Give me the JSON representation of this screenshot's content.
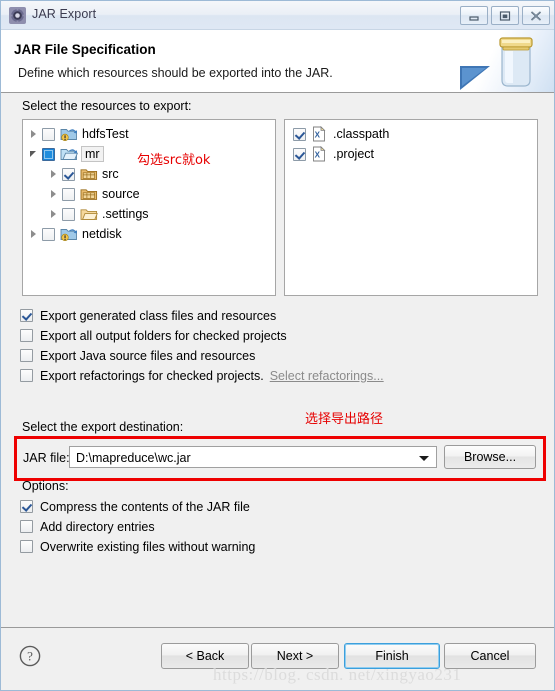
{
  "window": {
    "title": "JAR Export",
    "title_icon": "jar-export-icon",
    "controls": {
      "minimize": "minimize-icon",
      "maximize": "maximize-icon",
      "close": "close-icon"
    }
  },
  "header": {
    "title": "JAR File Specification",
    "subtitle": "Define which resources should be exported into the JAR.",
    "art_icon": "jar-jar-illustration"
  },
  "resources": {
    "label": "Select the resources to export:",
    "tree": [
      {
        "label": "hdfsTest",
        "icon": "java-project-icon",
        "checked": "none",
        "expandable": true,
        "expanded": false,
        "indent": 0,
        "selected": false
      },
      {
        "label": "mr",
        "icon": "project-open-icon",
        "checked": "partial",
        "expandable": true,
        "expanded": true,
        "indent": 0,
        "selected": true
      },
      {
        "label": "src",
        "icon": "package-folder-icon",
        "checked": "checked",
        "expandable": true,
        "expanded": false,
        "indent": 1,
        "selected": false
      },
      {
        "label": "source",
        "icon": "package-folder-icon",
        "checked": "none",
        "expandable": true,
        "expanded": false,
        "indent": 1,
        "selected": false
      },
      {
        "label": ".settings",
        "icon": "folder-icon",
        "checked": "none",
        "expandable": true,
        "expanded": false,
        "indent": 1,
        "selected": false
      },
      {
        "label": "netdisk",
        "icon": "java-project-icon",
        "checked": "none",
        "expandable": true,
        "expanded": false,
        "indent": 0,
        "selected": false
      }
    ],
    "files": [
      {
        "label": ".classpath",
        "icon": "xml-file-icon",
        "checked": true
      },
      {
        "label": ".project",
        "icon": "xml-file-icon",
        "checked": true
      }
    ]
  },
  "export_options": [
    {
      "label": "Export generated class files and resources",
      "checked": true,
      "link": null
    },
    {
      "label": "Export all output folders for checked projects",
      "checked": false,
      "link": null
    },
    {
      "label": "Export Java source files and resources",
      "checked": false,
      "link": null
    },
    {
      "label": "Export refactorings for checked projects.",
      "checked": false,
      "link": "Select refactorings..."
    }
  ],
  "destination": {
    "label": "Select the export destination:",
    "field_label": "JAR file:",
    "value": "D:\\mapreduce\\wc.jar",
    "placeholder": "",
    "browse_label": "Browse..."
  },
  "options": {
    "label": "Options:",
    "items": [
      {
        "label": "Compress the contents of the JAR file",
        "checked": true
      },
      {
        "label": "Add directory entries",
        "checked": false
      },
      {
        "label": "Overwrite existing files without warning",
        "checked": false
      }
    ]
  },
  "footer": {
    "help_icon": "help-question-icon",
    "buttons": [
      {
        "label": "< Back",
        "focused": false
      },
      {
        "label": "Next >",
        "focused": false
      },
      {
        "label": "Finish",
        "focused": true
      },
      {
        "label": "Cancel",
        "focused": false
      }
    ]
  },
  "annotations": [
    {
      "text": "勾选src就ok",
      "name": "annotation-check-src"
    },
    {
      "text": "选择导出路径",
      "name": "annotation-choose-path"
    }
  ],
  "watermark": "https://blog. csdn. net/xingyao231",
  "colors": {
    "annotation_red": "#ee0000",
    "accent_blue": "#3c9fdc",
    "window_bg": "#f0f0f0"
  }
}
